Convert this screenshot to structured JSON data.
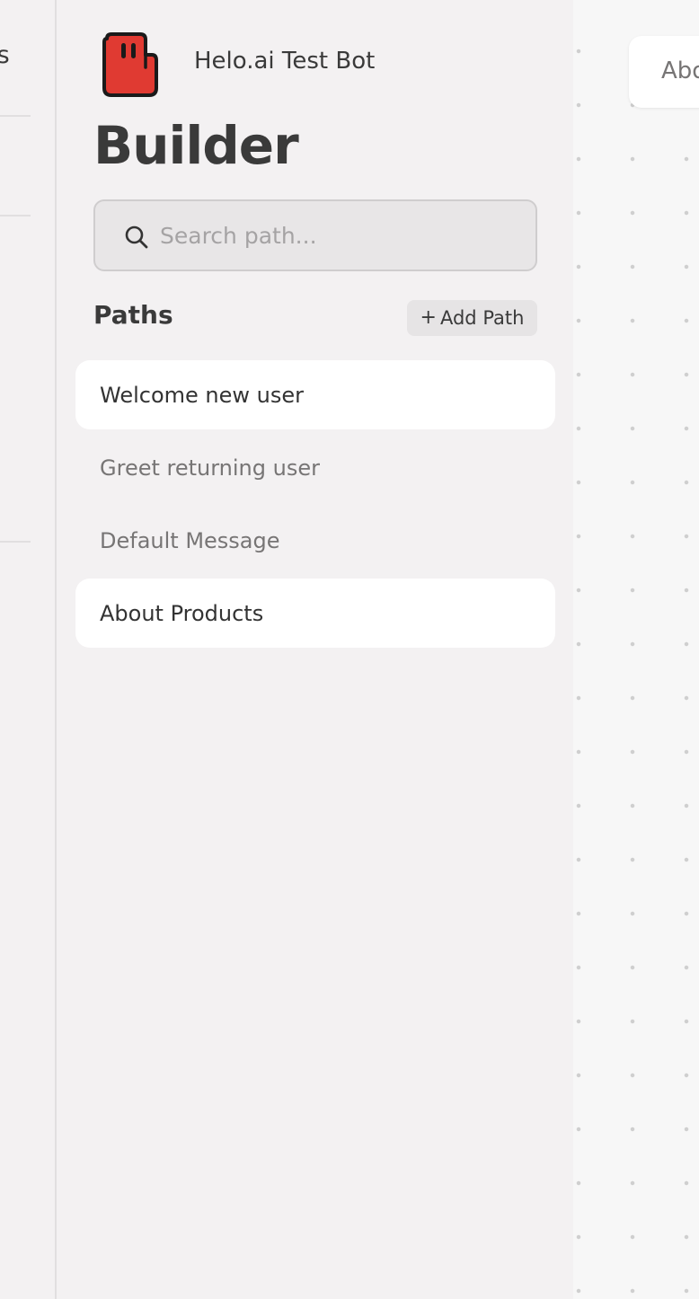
{
  "left_rail": {
    "cut_text": "ts"
  },
  "sidebar": {
    "bot_name": "Helo.ai Test Bot",
    "page_title": "Builder",
    "search": {
      "placeholder": "Search path...",
      "value": ""
    },
    "paths_heading": "Paths",
    "add_path_label": "Add Path",
    "add_path_icon": "+",
    "paths": [
      {
        "label": "Welcome new user",
        "active": true
      },
      {
        "label": "Greet returning user",
        "active": false
      },
      {
        "label": "Default Message",
        "active": false
      },
      {
        "label": "About Products",
        "active": true
      }
    ]
  },
  "canvas": {
    "node_label": "Abo"
  },
  "colors": {
    "brand_red": "#e03a32",
    "sidebar_bg": "#f3f1f2",
    "canvas_bg": "#f7f7f7",
    "text_primary": "#333333",
    "text_muted": "#777575"
  },
  "icons": {
    "bot_logo": "hand-logo-icon",
    "search": "search-icon",
    "add": "plus-icon"
  }
}
